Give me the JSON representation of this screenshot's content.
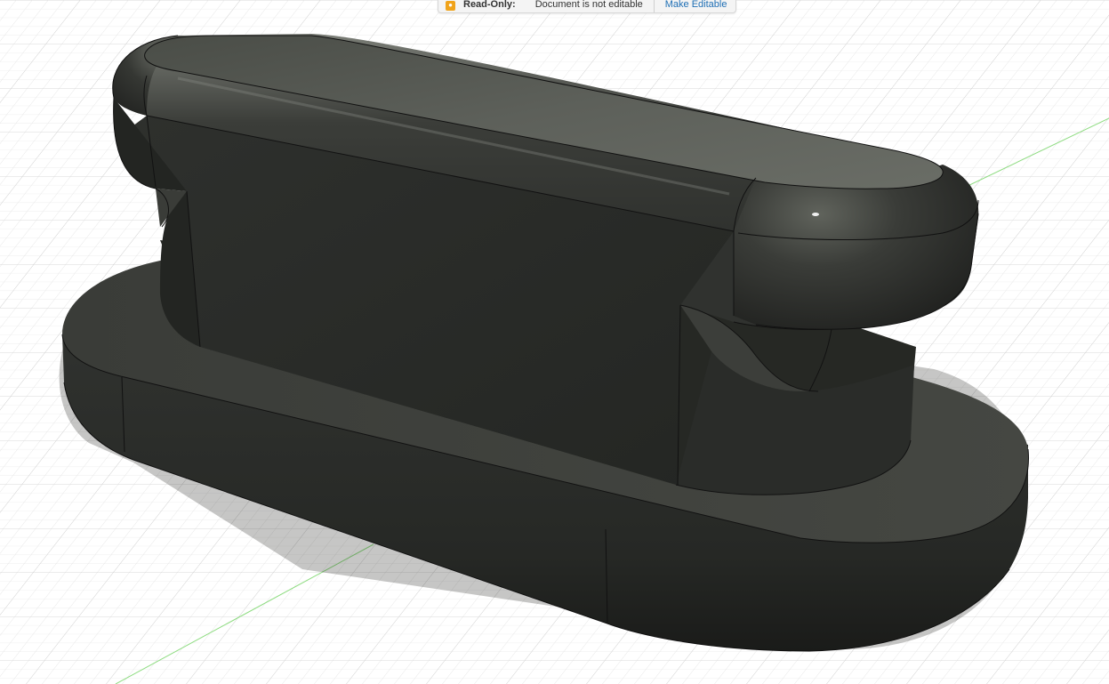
{
  "notice": {
    "label": "Read-Only:",
    "message": "Document is not editable",
    "action": "Make Editable",
    "icon": "lock-icon",
    "icon_color": "#f0a31a",
    "link_color": "#1f6fb5"
  },
  "viewport": {
    "background": "#ffffff",
    "grid_color": "#dcdcdc",
    "axis_color": "#7ddc74",
    "model_color": "#2d2f2c"
  }
}
